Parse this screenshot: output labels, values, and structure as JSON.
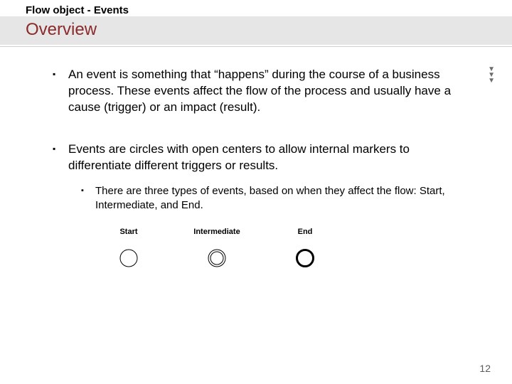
{
  "header": {
    "kicker": "Flow object - Events",
    "title": "Overview"
  },
  "bullets": {
    "b1": "An event is something that “happens” during the course of a business process. These events affect the flow of the process and usually have a cause (trigger) or an impact (result).",
    "b2": "Events are circles with open centers to allow internal markers to differentiate different triggers or results.",
    "b2a": "There are three types of events, based on when they affect the flow: Start, Intermediate, and End."
  },
  "events": {
    "start": "Start",
    "intermediate": "Intermediate",
    "end": "End"
  },
  "page_number": "12"
}
